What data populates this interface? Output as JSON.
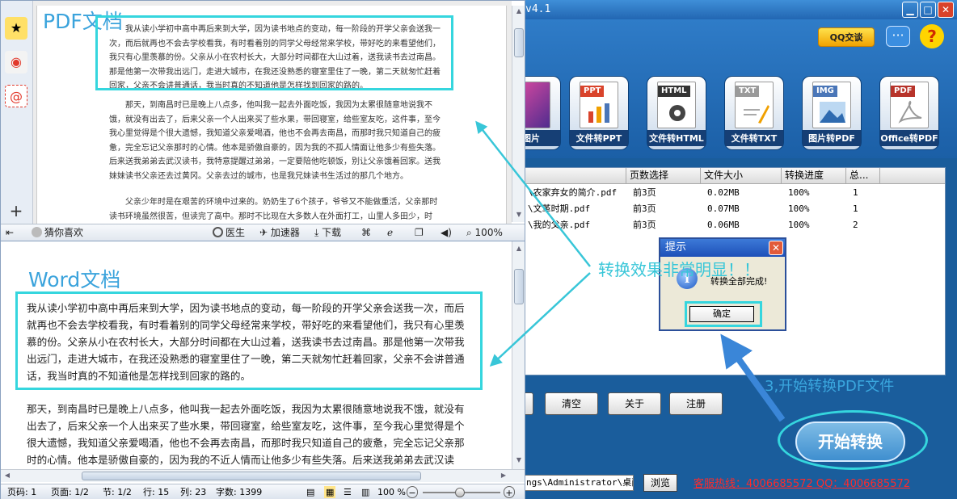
{
  "app": {
    "version": "v4.1",
    "qq_label": "QQ交谈",
    "help_glyph": "?",
    "tools": [
      {
        "tag": "",
        "label": "图片",
        "color": "#8b2f8f"
      },
      {
        "tag": "PPT",
        "label": "文件转PPT",
        "color": "#d9432b"
      },
      {
        "tag": "HTML",
        "label": "文件转HTML",
        "color": "#333333"
      },
      {
        "tag": "TXT",
        "label": "文件转TXT",
        "color": "#8a8a8a"
      },
      {
        "tag": "IMG",
        "label": "图片转PDF",
        "color": "#4a76b8"
      },
      {
        "tag": "PDF",
        "label": "Office转PDF",
        "color": "#b7332a"
      }
    ],
    "table": {
      "headers": [
        "",
        "页数选择",
        "文件大小",
        "转换进度",
        "总..."
      ],
      "rows": [
        [
          "\\农家弃女的简介.pdf",
          "前3页",
          "0.02MB",
          "100%",
          "1"
        ],
        [
          "\\文革时期.pdf",
          "前3页",
          "0.07MB",
          "100%",
          "1"
        ],
        [
          "\\我的父亲.pdf",
          "前3页",
          "0.06MB",
          "100%",
          "2"
        ]
      ]
    },
    "buttons": {
      "clear": "清空",
      "about": "关于",
      "register": "注册",
      "start": "开始转换",
      "browse": "浏览"
    },
    "path_value": "ngs\\Administrator\\桌面",
    "hotline": "客服热线：4006685572 QQ：4006685572"
  },
  "dialog": {
    "title": "提示",
    "close": "✕",
    "icon": "i",
    "message": "转换全部完成!",
    "ok": "确定"
  },
  "pdf": {
    "title": "PDF文档",
    "paragraphs": [
      "我从读小学初中高中再后来到大学，因为读书地点的变动，每一阶段的开学父亲会送我一次，而后就再也不会去学校看我，有时看着别的同学父母经常来学校，带好吃的来看望他们，我只有心里羡慕的份。父亲从小在农村长大，大部分时间都在大山过着，送我读书去过南昌。那是他第一次带我出远门，走进大城市，在我还没熟悉的寝室里住了一晚，第二天就匆忙赶着回家，父亲不会讲普通话，我当时真的不知道他是怎样找到回家的路的。",
      "那天，到南昌时已是晚上八点多，他叫我一起去外面吃饭，我因为太累很随意地说我不饿，就没有出去了，后来父亲一个人出来买了些水果，带回寝室，给些室友吃，这件事，至今我心里觉得是个很大遗憾，我知道父亲爱喝酒，他也不会再去南昌，而那时我只知道自己的疲惫，完全忘记父亲那时的心情。他本是骄傲自豪的，因为我的不孤人情面让他多少有些失落。后来送我弟弟去武汉读书，我特意提醒过弟弟，一定要陪他吃顿饭，别让父亲饿着回家。送我妹妹读书父亲还去过黄冈。父亲去过的城市，也是我兄妹读书生活过的那几个地方。",
      "父亲少年时是在艰苦的环境中过来的。奶奶生了6个孩子，爷爷又不能做重活，父亲那时读书环境虽然很苦，但读完了高中。那时不比现在大多数人在外面打工，山里人多田少，时"
    ],
    "status": {
      "guess": "猜你喜欢",
      "doctor": "医生",
      "accel": "加速器",
      "download": "下载",
      "zoom": "100%"
    }
  },
  "word": {
    "title": "Word文档",
    "paragraphs": [
      "我从读小学初中高中再后来到大学，因为读书地点的变动，每一阶段的开学父亲会送我一次，而后就再也不会去学校看我，有时看着别的同学父母经常来学校，带好吃的来看望他们，我只有心里羡慕的份。父亲从小在农村长大，大部分时间都在大山过着，送我读书去过南昌。那是他第一次带我出远门，走进大城市，在我还没熟悉的寝室里住了一晚，第二天就匆忙赶着回家，父亲不会讲普通话，我当时真的不知道他是怎样找到回家的路的。",
      "那天，到南昌时已是晚上八点多，他叫我一起去外面吃饭，我因为太累很随意地说我不饿，就没有出去了，后来父亲一个人出来买了些水果，带回寝室，给些室友吃，这件事，至今我心里觉得是个很大遗憾，我知道父亲爱喝酒，他也不会再去南昌，而那时我只知道自己的疲惫，完全忘记父亲那时的心情。他本是骄傲自豪的，因为我的不近人情而让他多少有些失落。后来送我弟弟去武汉读书，我特意提醒过弟弟，一定要陪他吃顿饭，别让父亲"
    ],
    "status": {
      "pages": "页码: 1",
      "page": "页面: 1/2",
      "section": "节: 1/2",
      "row": "行: 15",
      "col": "列: 23",
      "words": "字数: 1399",
      "zoom": "100 %",
      "minus": "−",
      "plus": "+"
    }
  },
  "annotations": {
    "effect": "转换效果非常明显！！",
    "step": "3,开始转换PDF文件"
  },
  "colors": {
    "accent": "#35d6de",
    "app_bg": "#1a5d9c",
    "title_blue": "#3aa3dc",
    "hotline": "#ff2a2a"
  }
}
